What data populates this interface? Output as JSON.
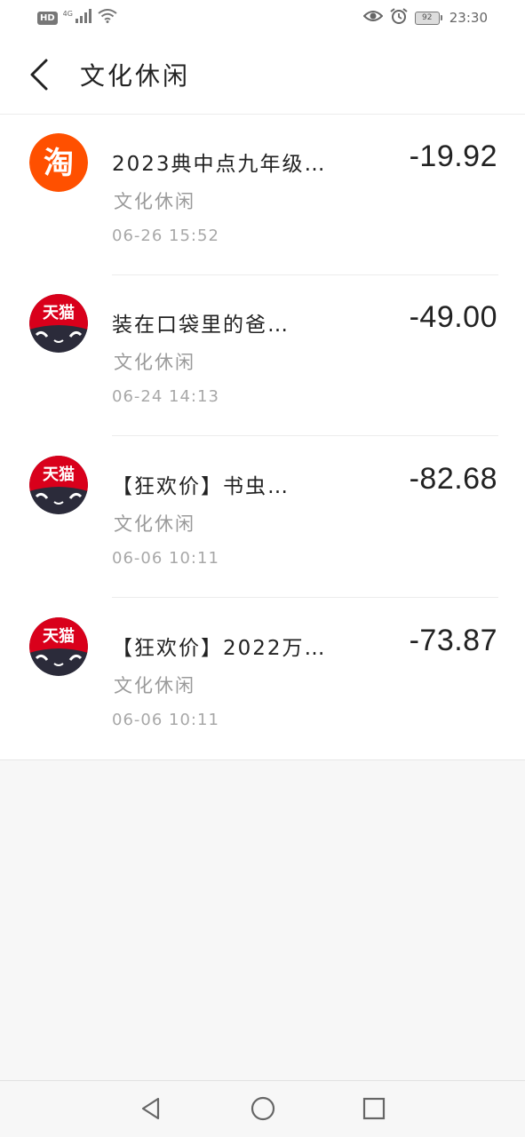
{
  "status_bar": {
    "hd_label": "HD",
    "network_label": "4G",
    "battery": "92",
    "time": "23:30",
    "icons": [
      "signal-icon",
      "wifi-icon",
      "eye-icon",
      "alarm-icon",
      "battery-icon"
    ]
  },
  "header": {
    "back_icon": "chevron-left-icon",
    "title": "文化休闲"
  },
  "items": [
    {
      "logo": "taobao-logo",
      "logo_text": "淘",
      "title": "2023典中点九年级…",
      "category": "文化休闲",
      "date": "06-26  15:52",
      "amount": "-19.92"
    },
    {
      "logo": "tmall-logo",
      "logo_text": "天猫",
      "title": "装在口袋里的爸…",
      "category": "文化休闲",
      "date": "06-24  14:13",
      "amount": "-49.00"
    },
    {
      "logo": "tmall-logo",
      "logo_text": "天猫",
      "title": "【狂欢价】书虫…",
      "category": "文化休闲",
      "date": "06-06  10:11",
      "amount": "-82.68"
    },
    {
      "logo": "tmall-logo",
      "logo_text": "天猫",
      "title": "【狂欢价】2022万…",
      "category": "文化休闲",
      "date": "06-06  10:11",
      "amount": "-73.87"
    }
  ],
  "nav": {
    "icons": [
      "back-triangle-icon",
      "home-circle-icon",
      "recents-square-icon"
    ]
  },
  "colors": {
    "taobao": "#ff5000",
    "tmall_red": "#d9001b",
    "tmall_dark": "#2b2b3a"
  }
}
